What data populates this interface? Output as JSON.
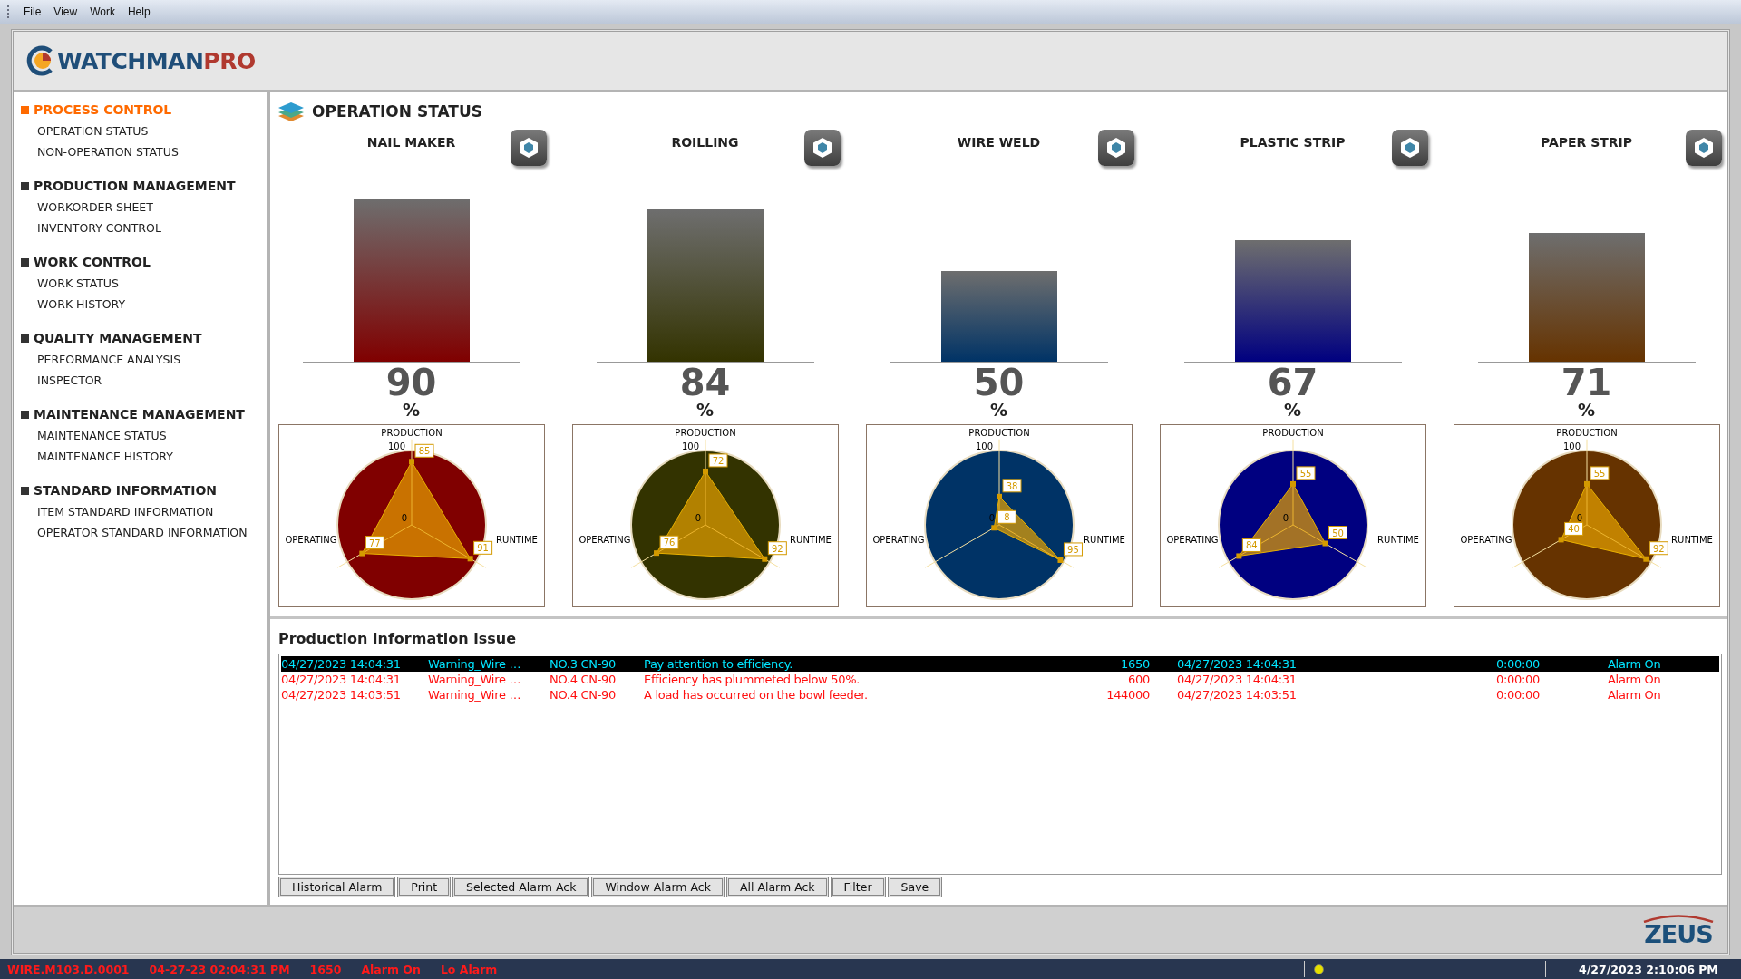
{
  "menu": [
    "File",
    "View",
    "Work",
    "Help"
  ],
  "logo": {
    "part_1": "WATCHMAN",
    "part_2": "PRO"
  },
  "sidebar": [
    {
      "title": "PROCESS CONTROL",
      "selected": true,
      "items": [
        "OPERATION STATUS",
        "NON-OPERATION STATUS"
      ]
    },
    {
      "title": "PRODUCTION MANAGEMENT",
      "selected": false,
      "items": [
        "WORKORDER SHEET",
        "INVENTORY CONTROL"
      ]
    },
    {
      "title": "WORK CONTROL",
      "selected": false,
      "items": [
        "WORK STATUS",
        "WORK HISTORY"
      ]
    },
    {
      "title": "QUALITY MANAGEMENT",
      "selected": false,
      "items": [
        "PERFORMANCE ANALYSIS",
        "INSPECTOR"
      ]
    },
    {
      "title": "MAINTENANCE MANAGEMENT",
      "selected": false,
      "items": [
        "MAINTENANCE STATUS",
        "MAINTENANCE HISTORY"
      ]
    },
    {
      "title": "STANDARD INFORMATION",
      "selected": false,
      "items": [
        "ITEM STANDARD INFORMATION",
        "OPERATOR STANDARD INFORMATION"
      ]
    }
  ],
  "page_title": "OPERATION STATUS",
  "machines": [
    {
      "name": "NAIL MAKER",
      "reading": "90",
      "unit": "%",
      "color": "#800000",
      "radar": {
        "max_label": "100",
        "min_label": "0",
        "axes": [
          {
            "label": "PRODUCTION",
            "value": "85"
          },
          {
            "label": "OPERATING",
            "value": "77"
          },
          {
            "label": "RUNTIME",
            "value": "91"
          }
        ]
      }
    },
    {
      "name": "ROILLING",
      "reading": "84",
      "unit": "%",
      "color": "#333300",
      "radar": {
        "max_label": "100",
        "min_label": "0",
        "axes": [
          {
            "label": "PRODUCTION",
            "value": "72"
          },
          {
            "label": "OPERATING",
            "value": "76"
          },
          {
            "label": "RUNTIME",
            "value": "92"
          }
        ]
      }
    },
    {
      "name": "WIRE WELD",
      "reading": "50",
      "unit": "%",
      "color": "#003366",
      "radar": {
        "max_label": "100",
        "min_label": "0",
        "axes": [
          {
            "label": "PRODUCTION",
            "value": "38"
          },
          {
            "label": "OPERATING",
            "value": "8"
          },
          {
            "label": "RUNTIME",
            "value": "95"
          }
        ]
      }
    },
    {
      "name": "PLASTIC STRIP",
      "reading": "67",
      "unit": "%",
      "color": "#000080",
      "radar": {
        "min_label": "0",
        "axes": [
          {
            "label": "PRODUCTION",
            "value": "55"
          },
          {
            "label": "OPERATING",
            "value": "84"
          },
          {
            "label": "RUNTIME",
            "value": "50"
          }
        ]
      }
    },
    {
      "name": "PAPER STRIP",
      "reading": "71",
      "unit": "%",
      "color": "#663300",
      "radar": {
        "max_label": "100",
        "min_label": "0",
        "axes": [
          {
            "label": "PRODUCTION",
            "value": "55"
          },
          {
            "label": "OPERATING",
            "value": "40"
          },
          {
            "label": "RUNTIME",
            "value": "92"
          }
        ]
      }
    }
  ],
  "alarms": {
    "title": "Production information issue",
    "rows": [
      {
        "selected": true,
        "cells": [
          "04/27/2023 14:04:31",
          "Warning_Wire …",
          "NO.3 CN-90",
          "Pay attention to efficiency.",
          "1650",
          "04/27/2023 14:04:31",
          "0:00:00",
          "Alarm On"
        ]
      },
      {
        "selected": false,
        "cells": [
          "04/27/2023 14:04:31",
          "Warning_Wire …",
          "NO.4 CN-90",
          "Efficiency has plummeted below 50%.",
          "600",
          "04/27/2023 14:04:31",
          "0:00:00",
          "Alarm On"
        ]
      },
      {
        "selected": false,
        "cells": [
          "04/27/2023 14:03:51",
          "Warning_Wire …",
          "NO.4 CN-90",
          "A load has occurred on the bowl feeder.",
          "144000",
          "04/27/2023 14:03:51",
          "0:00:00",
          "Alarm On"
        ]
      }
    ],
    "buttons": [
      "Historical Alarm",
      "Print",
      "Selected Alarm Ack",
      "Window Alarm Ack",
      "All Alarm Ack",
      "Filter",
      "Save"
    ]
  },
  "footer_logo": "ZEUS",
  "status_bar": {
    "alarm": [
      "WIRE.M103.D.0001",
      "04-27-23 02:04:31 PM",
      "1650",
      "Alarm On",
      "Lo Alarm"
    ],
    "datetime": "4/27/2023 2:10:06 PM"
  }
}
